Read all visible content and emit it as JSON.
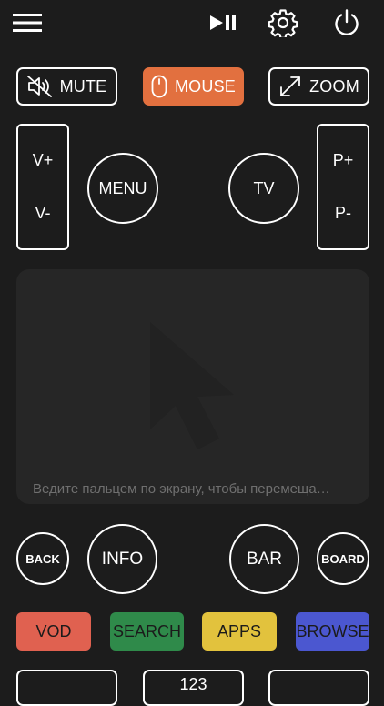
{
  "topbar": {
    "menu_icon": "hamburger-icon",
    "play_icon": "play-pause-icon",
    "settings_icon": "gear-icon",
    "power_icon": "power-icon"
  },
  "mode_buttons": {
    "mute": "MUTE",
    "mouse": "MOUSE",
    "zoom": "ZOOM"
  },
  "volume": {
    "up": "V+",
    "down": "V-"
  },
  "program": {
    "up": "P+",
    "down": "P-"
  },
  "menu_label": "MENU",
  "tv_label": "TV",
  "touchpad": {
    "hint": "Ведите пальцем по экрану, чтобы перемеща…"
  },
  "nav_buttons": {
    "back": "BACK",
    "info": "INFO",
    "bar": "BAR",
    "board": "BOARD"
  },
  "color_buttons": [
    {
      "label": "VOD",
      "color": "#e06150"
    },
    {
      "label": "SEARCH",
      "color": "#2f8a4a"
    },
    {
      "label": "APPS",
      "color": "#e2c23d"
    },
    {
      "label": "BROWSE",
      "color": "#4b57d0"
    }
  ],
  "bottom_partial": {
    "middle_text": "123"
  },
  "colors": {
    "background": "#1c1c1c",
    "accent": "#e2703f",
    "touchpad": "#262626"
  }
}
